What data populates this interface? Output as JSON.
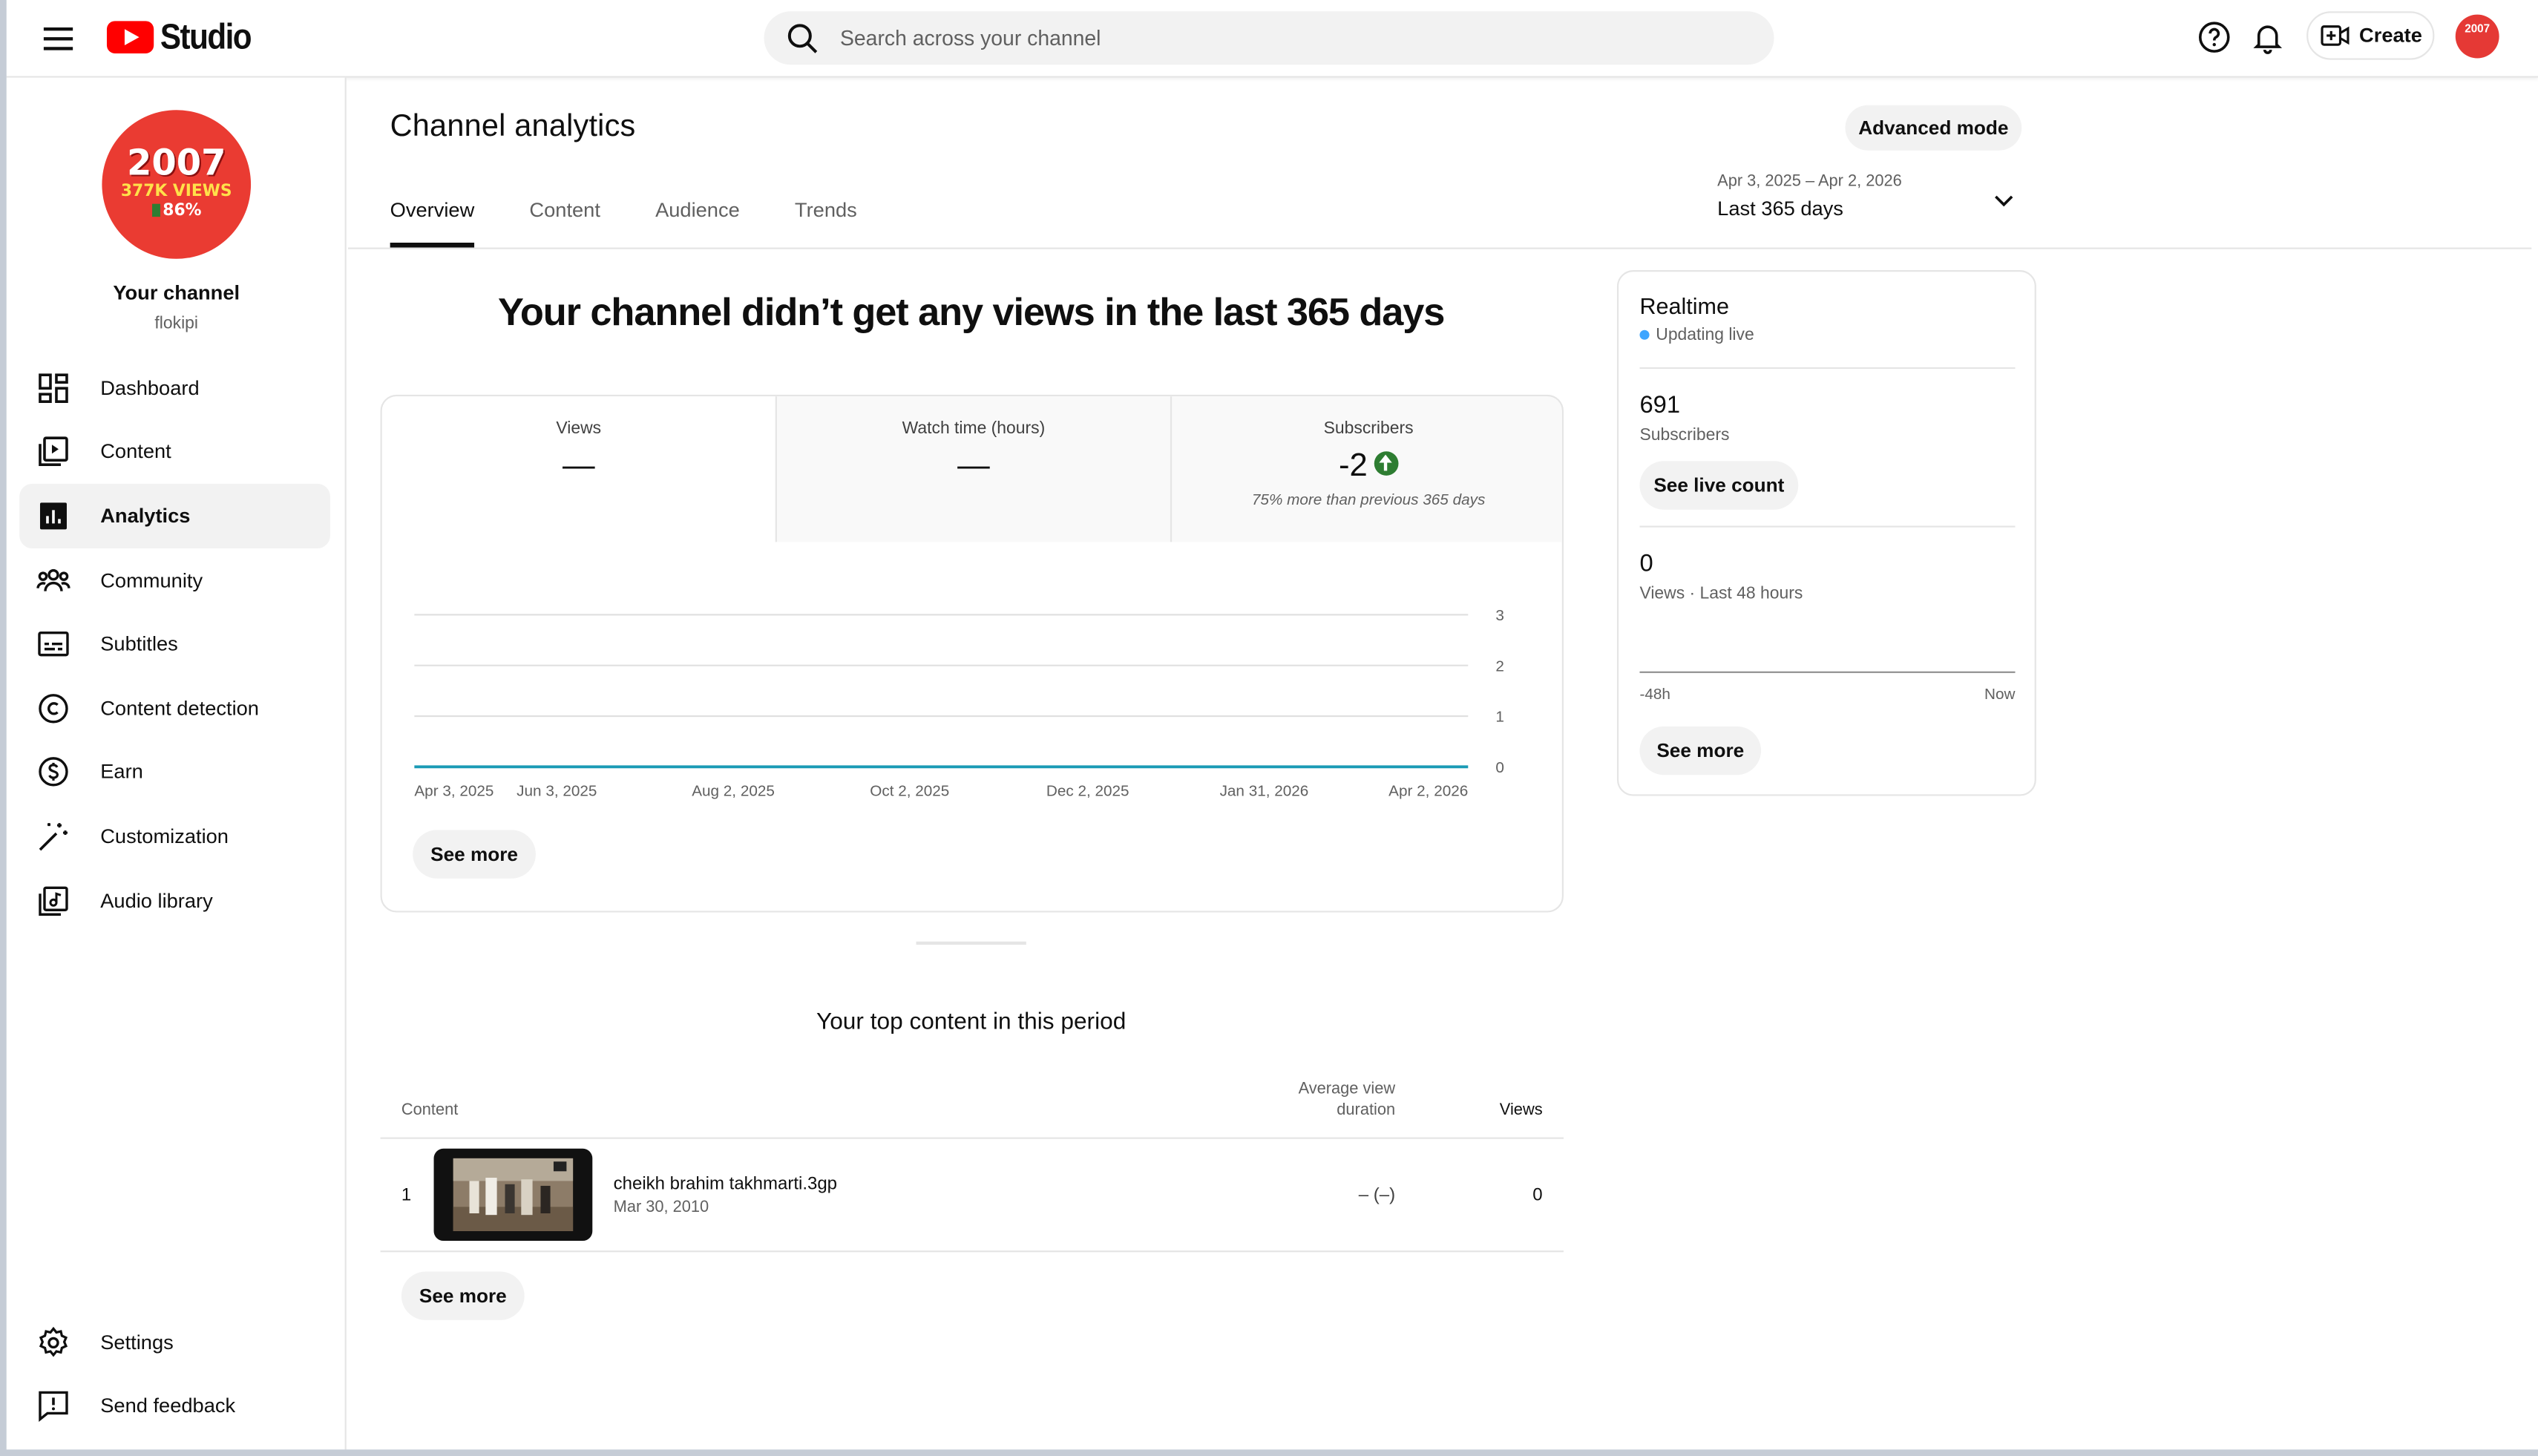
{
  "header": {
    "logo_text": "Studio",
    "search_placeholder": "Search across your channel",
    "create_label": "Create",
    "avatar_text": "2007"
  },
  "sidebar": {
    "channel_avatar": {
      "line1": "2007",
      "line2": "377K VIEWS",
      "line3": "86%"
    },
    "channel_title": "Your channel",
    "channel_handle": "flokipi",
    "items": [
      {
        "label": "Dashboard",
        "icon": "dashboard-icon"
      },
      {
        "label": "Content",
        "icon": "content-icon"
      },
      {
        "label": "Analytics",
        "icon": "analytics-icon",
        "active": true
      },
      {
        "label": "Community",
        "icon": "community-icon"
      },
      {
        "label": "Subtitles",
        "icon": "subtitles-icon"
      },
      {
        "label": "Content detection",
        "icon": "copyright-icon"
      },
      {
        "label": "Earn",
        "icon": "earn-icon"
      },
      {
        "label": "Customization",
        "icon": "magic-wand-icon"
      },
      {
        "label": "Audio library",
        "icon": "audio-library-icon"
      }
    ],
    "bottom_items": [
      {
        "label": "Settings",
        "icon": "gear-icon"
      },
      {
        "label": "Send feedback",
        "icon": "feedback-icon"
      }
    ]
  },
  "main": {
    "title": "Channel analytics",
    "advanced_mode": "Advanced mode",
    "date_range_sub": "Apr 3, 2025 – Apr 2, 2026",
    "date_range_main": "Last 365 days",
    "tabs": [
      "Overview",
      "Content",
      "Audience",
      "Trends"
    ],
    "headline": "Your channel didn’t get any views in the last 365 days",
    "metrics": [
      {
        "label": "Views",
        "value": "—"
      },
      {
        "label": "Watch time (hours)",
        "value": "—"
      },
      {
        "label": "Subscribers",
        "value": "-2",
        "note": "75% more than previous 365 days"
      }
    ],
    "see_more": "See more",
    "top_content_title": "Your top content in this period",
    "table": {
      "col_content": "Content",
      "col_avd": "Average view duration",
      "col_views": "Views",
      "rows": [
        {
          "rank": "1",
          "title": "cheikh brahim takhmarti.3gp",
          "date": "Mar 30, 2010",
          "avd": "– (–)",
          "views": "0"
        }
      ]
    },
    "see_more_table": "See more"
  },
  "chart_data": {
    "type": "line",
    "x": [
      "Apr 3, 2025",
      "Jun 3, 2025",
      "Aug 2, 2025",
      "Oct 2, 2025",
      "Dec 2, 2025",
      "Jan 31, 2026",
      "Apr 2, 2026"
    ],
    "series": [
      {
        "values": [
          0,
          0,
          0,
          0,
          0,
          0,
          0
        ]
      }
    ],
    "y_ticks": [
      "0",
      "1",
      "2",
      "3"
    ],
    "ylim": [
      0,
      3
    ],
    "grid": true,
    "line_color": "#1a9bb5"
  },
  "realtime": {
    "title": "Realtime",
    "status": "Updating live",
    "subscribers_value": "691",
    "subscribers_label": "Subscribers",
    "see_live_count": "See live count",
    "views_value": "0",
    "views_label": "Views · Last 48 hours",
    "axis_start": "-48h",
    "axis_end": "Now",
    "see_more": "See more"
  }
}
